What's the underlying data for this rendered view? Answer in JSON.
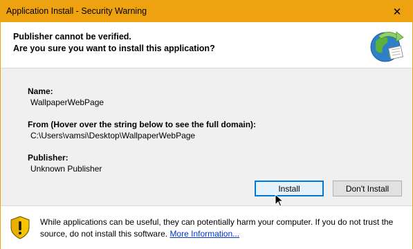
{
  "window": {
    "title": "Application Install - Security Warning",
    "close_symbol": "✕",
    "accent_color": "#efa210"
  },
  "header": {
    "line1": "Publisher cannot be verified.",
    "line2": "Are you sure you want to install this application?",
    "icon": "globe-install-icon"
  },
  "details": {
    "name_label": "Name:",
    "name_value": "WallpaperWebPage",
    "from_label": "From (Hover over the string below to see the full domain):",
    "from_value": "C:\\Users\\vamsi\\Desktop\\WallpaperWebPage",
    "publisher_label": "Publisher:",
    "publisher_value": "Unknown Publisher"
  },
  "buttons": {
    "install": "Install",
    "dont_install": "Don't Install"
  },
  "footer": {
    "icon": "warning-shield-icon",
    "warning_text": "While applications can be useful, they can potentially harm your computer. If you do not trust the source, do not install this software. ",
    "link_text": "More Information..."
  }
}
